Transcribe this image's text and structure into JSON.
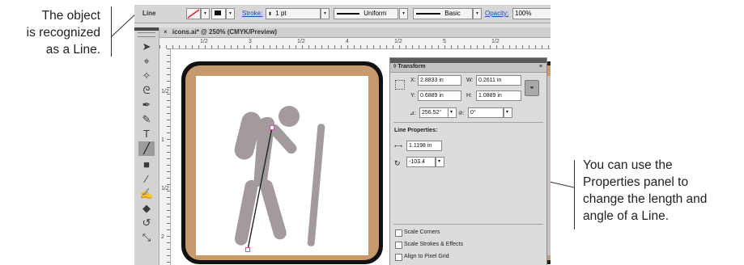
{
  "callouts": {
    "left": [
      "The object",
      "is recognized",
      "as a Line."
    ],
    "right": [
      "You can use the",
      "Properties panel to",
      "change the length and",
      "angle of a Line."
    ]
  },
  "control_bar": {
    "object_type": "Line",
    "stroke_label": "Stroke:",
    "stroke_weight": "1 pt",
    "profile": "Uniform",
    "brush": "Basic",
    "opacity_label": "Opacity:",
    "opacity_value": "100%"
  },
  "document_tab": {
    "close": "×",
    "title": "icons.ai* @ 250% (CMYK/Preview)"
  },
  "ruler": {
    "h_labels": [
      "1/2",
      "3",
      "1/2",
      "4",
      "1/2",
      "5",
      "1/2"
    ],
    "v_labels": [
      "1/2",
      "1",
      "1/2",
      "2"
    ]
  },
  "tools": [
    {
      "name": "selection-tool-icon",
      "glyph": "➤"
    },
    {
      "name": "direct-selection-tool-icon",
      "glyph": "⌖"
    },
    {
      "name": "magic-wand-tool-icon",
      "glyph": "✧"
    },
    {
      "name": "lasso-tool-icon",
      "glyph": "ᘓ"
    },
    {
      "name": "pen-tool-icon",
      "glyph": "✒"
    },
    {
      "name": "curvature-tool-icon",
      "glyph": "✎"
    },
    {
      "name": "type-tool-icon",
      "glyph": "T"
    },
    {
      "name": "line-segment-tool-icon",
      "glyph": "╱"
    },
    {
      "name": "rectangle-tool-icon",
      "glyph": "■"
    },
    {
      "name": "paintbrush-tool-icon",
      "glyph": "⁄"
    },
    {
      "name": "shaper-tool-icon",
      "glyph": "✍"
    },
    {
      "name": "eraser-tool-icon",
      "glyph": "◆"
    },
    {
      "name": "rotate-tool-icon",
      "glyph": "↺"
    },
    {
      "name": "scale-tool-icon",
      "glyph": "⤡"
    }
  ],
  "transform_panel": {
    "title": "Transform",
    "menu_icon": "panel-menu-icon",
    "x_label": "X:",
    "x_value": "2.8833 in",
    "w_label": "W:",
    "w_value": "0.2611 in",
    "y_label": "Y:",
    "y_value": "0.6889 in",
    "h_label": "H:",
    "h_value": "1.0889 in",
    "rotate_value": "256.52°",
    "shear_value": "0°",
    "line_props_label": "Line Properties:",
    "length_value": "1.1198 in",
    "angle_value": "-103.4",
    "scale_corners": "Scale Corners",
    "scale_strokes": "Scale Strokes & Effects",
    "align_pixel": "Align to Pixel Grid"
  },
  "colors": {
    "icon_border": "#111111",
    "icon_frame": "#c69a6d",
    "figure": "#a39a9b",
    "selected_line": "#222222",
    "anchor": "#d94fae"
  }
}
